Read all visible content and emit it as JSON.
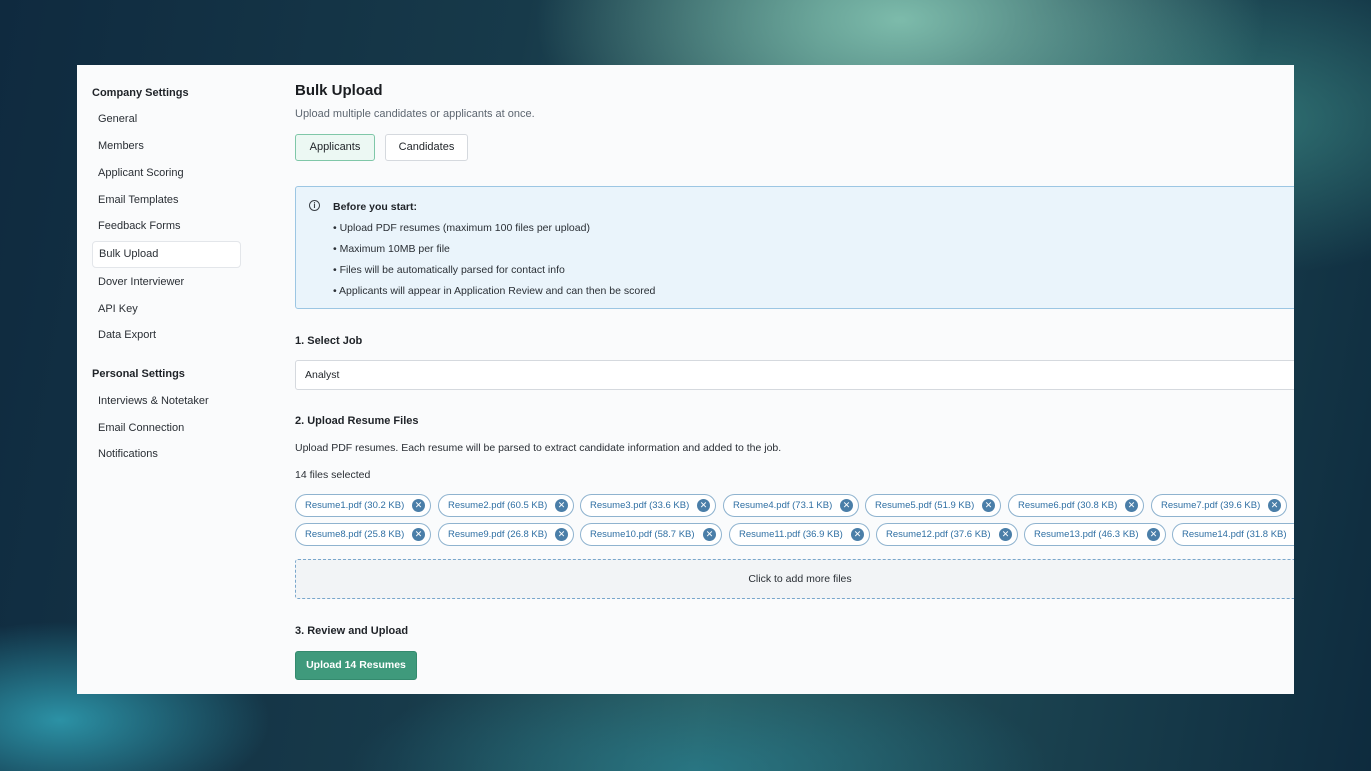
{
  "sidebar": {
    "company_heading": "Company Settings",
    "company_items": [
      {
        "label": "General"
      },
      {
        "label": "Members"
      },
      {
        "label": "Applicant Scoring"
      },
      {
        "label": "Email Templates"
      },
      {
        "label": "Feedback Forms"
      },
      {
        "label": "Bulk Upload",
        "active": true
      },
      {
        "label": "Dover Interviewer"
      },
      {
        "label": "API Key"
      },
      {
        "label": "Data Export"
      }
    ],
    "personal_heading": "Personal Settings",
    "personal_items": [
      {
        "label": "Interviews & Notetaker"
      },
      {
        "label": "Email Connection"
      },
      {
        "label": "Notifications"
      }
    ]
  },
  "page": {
    "title": "Bulk Upload",
    "subtitle": "Upload multiple candidates or applicants at once."
  },
  "tabs": [
    {
      "label": "Applicants",
      "active": true
    },
    {
      "label": "Candidates",
      "active": false
    }
  ],
  "info": {
    "icon": "info-icon",
    "title": "Before you start:",
    "items": [
      "Upload PDF resumes (maximum 100 files per upload)",
      "Maximum 10MB per file",
      "Files will be automatically parsed for contact info",
      "Applicants will appear in Application Review and can then be scored"
    ]
  },
  "step1": {
    "title": "1. Select Job",
    "selected_job": "Analyst"
  },
  "step2": {
    "title": "2. Upload Resume Files",
    "description": "Upload PDF resumes. Each resume will be parsed to extract candidate information and added to the job.",
    "count_text": "14 files selected",
    "files": [
      "Resume1.pdf (30.2 KB)",
      "Resume2.pdf (60.5 KB)",
      "Resume3.pdf (33.6 KB)",
      "Resume4.pdf (73.1 KB)",
      "Resume5.pdf (51.9 KB)",
      "Resume6.pdf (30.8 KB)",
      "Resume7.pdf (39.6 KB)",
      "Resume8.pdf (25.8 KB)",
      "Resume9.pdf (26.8 KB)",
      "Resume10.pdf (58.7 KB)",
      "Resume11.pdf (36.9 KB)",
      "Resume12.pdf (37.6 KB)",
      "Resume13.pdf (46.3 KB)",
      "Resume14.pdf (31.8 KB)"
    ],
    "dropzone_text": "Click to add more files"
  },
  "step3": {
    "title": "3. Review and Upload",
    "button_label": "Upload 14 Resumes"
  },
  "colors": {
    "accent": "#3f9a7c",
    "chip_text": "#2f6fa3",
    "info_bg": "#eaf4fb"
  }
}
